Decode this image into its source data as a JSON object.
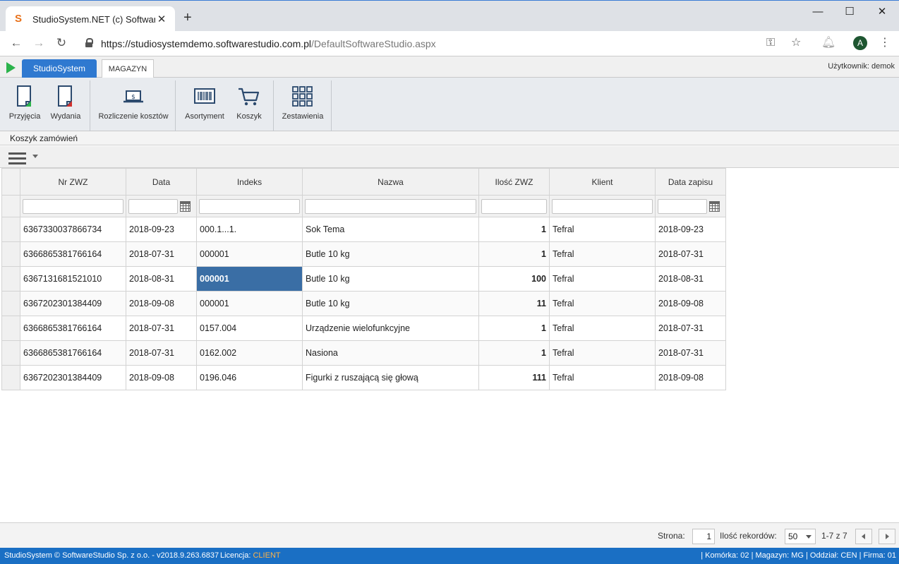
{
  "browser": {
    "tab_title": "StudioSystem.NET (c) SoftwareStudio",
    "url_host": "https://studiosystemdemo.softwarestudio.com.pl",
    "url_path": "/DefaultSoftwareStudio.aspx",
    "avatar_letter": "A"
  },
  "app": {
    "tab_main": "StudioSystem",
    "tab_module": "MAGAZYN",
    "user_label": "Użytkownik: demok"
  },
  "ribbon": {
    "przyjecia": "Przyjęcia",
    "wydania": "Wydania",
    "rozliczenie": "Rozliczenie kosztów",
    "asortyment": "Asortyment",
    "koszyk": "Koszyk",
    "zestawienia": "Zestawienia"
  },
  "page": {
    "title": "Koszyk zamówień"
  },
  "grid": {
    "columns": [
      "Nr ZWZ",
      "Data",
      "Indeks",
      "Nazwa",
      "Ilość ZWZ",
      "Klient",
      "Data zapisu"
    ],
    "rows": [
      [
        "6367330037866734",
        "2018-09-23",
        "000.1...1.",
        "Sok Tema",
        "1",
        "Tefral",
        "2018-09-23"
      ],
      [
        "6366865381766164",
        "2018-07-31",
        "000001",
        "Butle 10 kg",
        "1",
        "Tefral",
        "2018-07-31"
      ],
      [
        "6367131681521010",
        "2018-08-31",
        "000001",
        "Butle 10 kg",
        "100",
        "Tefral",
        "2018-08-31"
      ],
      [
        "6367202301384409",
        "2018-09-08",
        "000001",
        "Butle 10 kg",
        "11",
        "Tefral",
        "2018-09-08"
      ],
      [
        "6366865381766164",
        "2018-07-31",
        "0157.004",
        "Urządzenie wielofunkcyjne",
        "1",
        "Tefral",
        "2018-07-31"
      ],
      [
        "6366865381766164",
        "2018-07-31",
        "0162.002",
        "Nasiona",
        "1",
        "Tefral",
        "2018-07-31"
      ],
      [
        "6367202301384409",
        "2018-09-08",
        "0196.046",
        "Figurki z ruszającą się głową",
        "111",
        "Tefral",
        "2018-09-08"
      ]
    ]
  },
  "pager": {
    "page_label": "Strona:",
    "page_value": "1",
    "size_label": "Ilość rekordów:",
    "size_value": "50",
    "range": "1-7 z 7"
  },
  "status": {
    "left": "StudioSystem © SoftwareStudio Sp. z o.o. - v2018.9.263.6837",
    "license_label": "Licencja: ",
    "license_value": "CLIENT",
    "right": "| Komórka: 02 | Magazyn: MG | Oddział: CEN | Firma: 01"
  },
  "colors": {
    "accent": "#2f79d0",
    "statusbar": "#1a6fc4",
    "selected_cell": "#3a6ea5"
  }
}
